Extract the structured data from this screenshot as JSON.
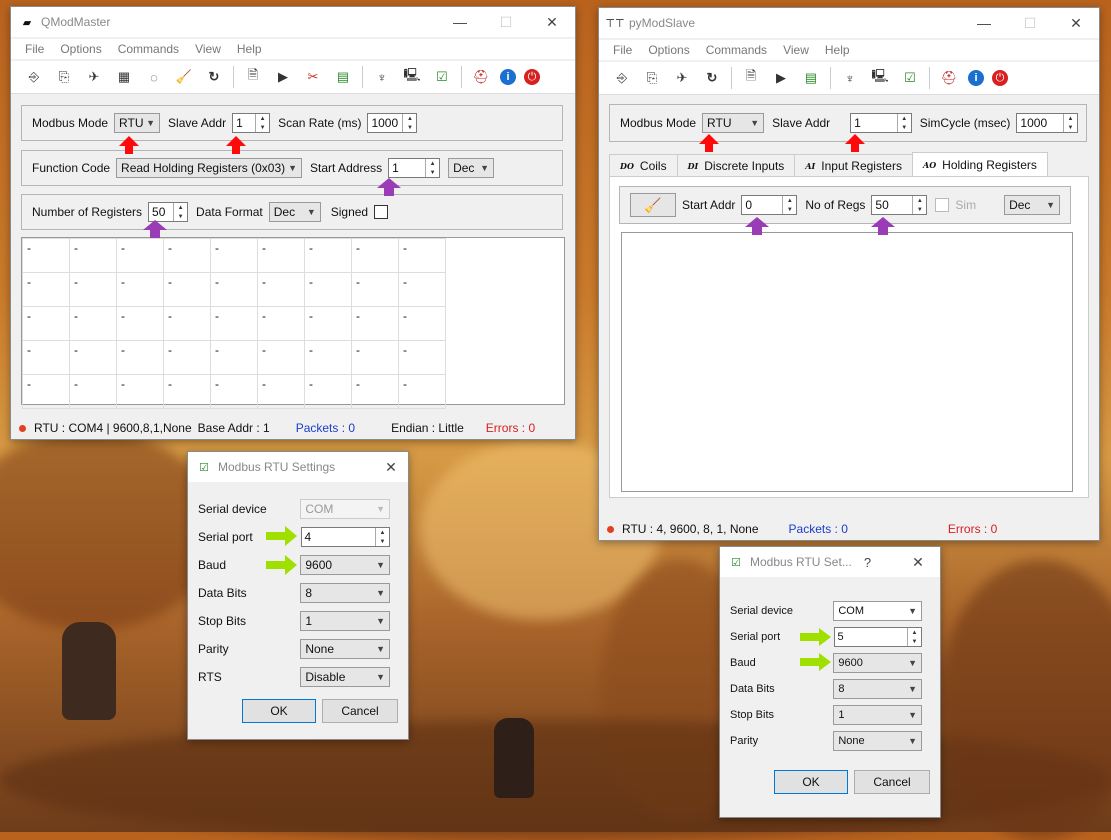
{
  "colors": {
    "accent_red": "#ff0a0a",
    "accent_purple": "#9b3cb7",
    "accent_green": "#9fe000",
    "link_blue": "#1a3ccc",
    "error_red": "#d42020"
  },
  "master": {
    "title": "QModMaster",
    "menu": [
      "File",
      "Options",
      "Commands",
      "View",
      "Help"
    ],
    "toolbar_icons": [
      "connect-icon",
      "disconnect-icon",
      "serial-icon",
      "tcp-icon",
      "refresh-icon",
      "clear-icon",
      "reload-icon",
      "log-icon",
      "monitor-icon",
      "tools-icon",
      "table-icon",
      "bus-icon",
      "settings-icon",
      "check-icon",
      "headless-icon",
      "info-icon",
      "exit-icon"
    ],
    "modbus_mode_label": "Modbus Mode",
    "modbus_mode_value": "RTU",
    "slave_addr_label": "Slave Addr",
    "slave_addr_value": "1",
    "scan_rate_label": "Scan Rate (ms)",
    "scan_rate_value": "1000",
    "function_code_label": "Function Code",
    "function_code_value": "Read Holding Registers (0x03)",
    "start_address_label": "Start Address",
    "start_address_value": "1",
    "format_value": "Dec",
    "num_registers_label": "Number of Registers",
    "num_registers_value": "50",
    "data_format_label": "Data Format",
    "data_format_value": "Dec",
    "signed_label": "Signed",
    "cell_placeholder": "-",
    "status": {
      "connection": "RTU : COM4 | 9600,8,1,None",
      "base_addr": "Base Addr : 1",
      "packets": "Packets : 0",
      "endian": "Endian : Little",
      "errors": "Errors : 0"
    }
  },
  "slave": {
    "title": "pyModSlave",
    "menu": [
      "File",
      "Options",
      "Commands",
      "View",
      "Help"
    ],
    "modbus_mode_label": "Modbus Mode",
    "modbus_mode_value": "RTU",
    "slave_addr_label": "Slave Addr",
    "slave_addr_value": "1",
    "sim_cycle_label": "SimCycle (msec)",
    "sim_cycle_value": "1000",
    "tabs": [
      {
        "badge": "DO",
        "label": "Coils"
      },
      {
        "badge": "DI",
        "label": "Discrete Inputs"
      },
      {
        "badge": "AI",
        "label": "Input Registers"
      },
      {
        "badge": "AO",
        "label": "Holding Registers"
      }
    ],
    "start_addr_label": "Start Addr",
    "start_addr_value": "0",
    "no_regs_label": "No of Regs",
    "no_regs_value": "50",
    "sim_label": "Sim",
    "format_value": "Dec",
    "status": {
      "connection": "RTU : 4, 9600, 8, 1, None",
      "packets": "Packets : 0",
      "errors": "Errors : 0"
    }
  },
  "master_dialog": {
    "title": "Modbus RTU Settings",
    "serial_device_label": "Serial device",
    "serial_device_value": "COM",
    "serial_port_label": "Serial port",
    "serial_port_value": "4",
    "baud_label": "Baud",
    "baud_value": "9600",
    "data_bits_label": "Data Bits",
    "data_bits_value": "8",
    "stop_bits_label": "Stop Bits",
    "stop_bits_value": "1",
    "parity_label": "Parity",
    "parity_value": "None",
    "rts_label": "RTS",
    "rts_value": "Disable",
    "ok": "OK",
    "cancel": "Cancel"
  },
  "slave_dialog": {
    "title": "Modbus RTU Set...",
    "help": "?",
    "serial_device_label": "Serial device",
    "serial_device_value": "COM",
    "serial_port_label": "Serial port",
    "serial_port_value": "5",
    "baud_label": "Baud",
    "baud_value": "9600",
    "data_bits_label": "Data Bits",
    "data_bits_value": "8",
    "stop_bits_label": "Stop Bits",
    "stop_bits_value": "1",
    "parity_label": "Parity",
    "parity_value": "None",
    "ok": "OK",
    "cancel": "Cancel"
  }
}
